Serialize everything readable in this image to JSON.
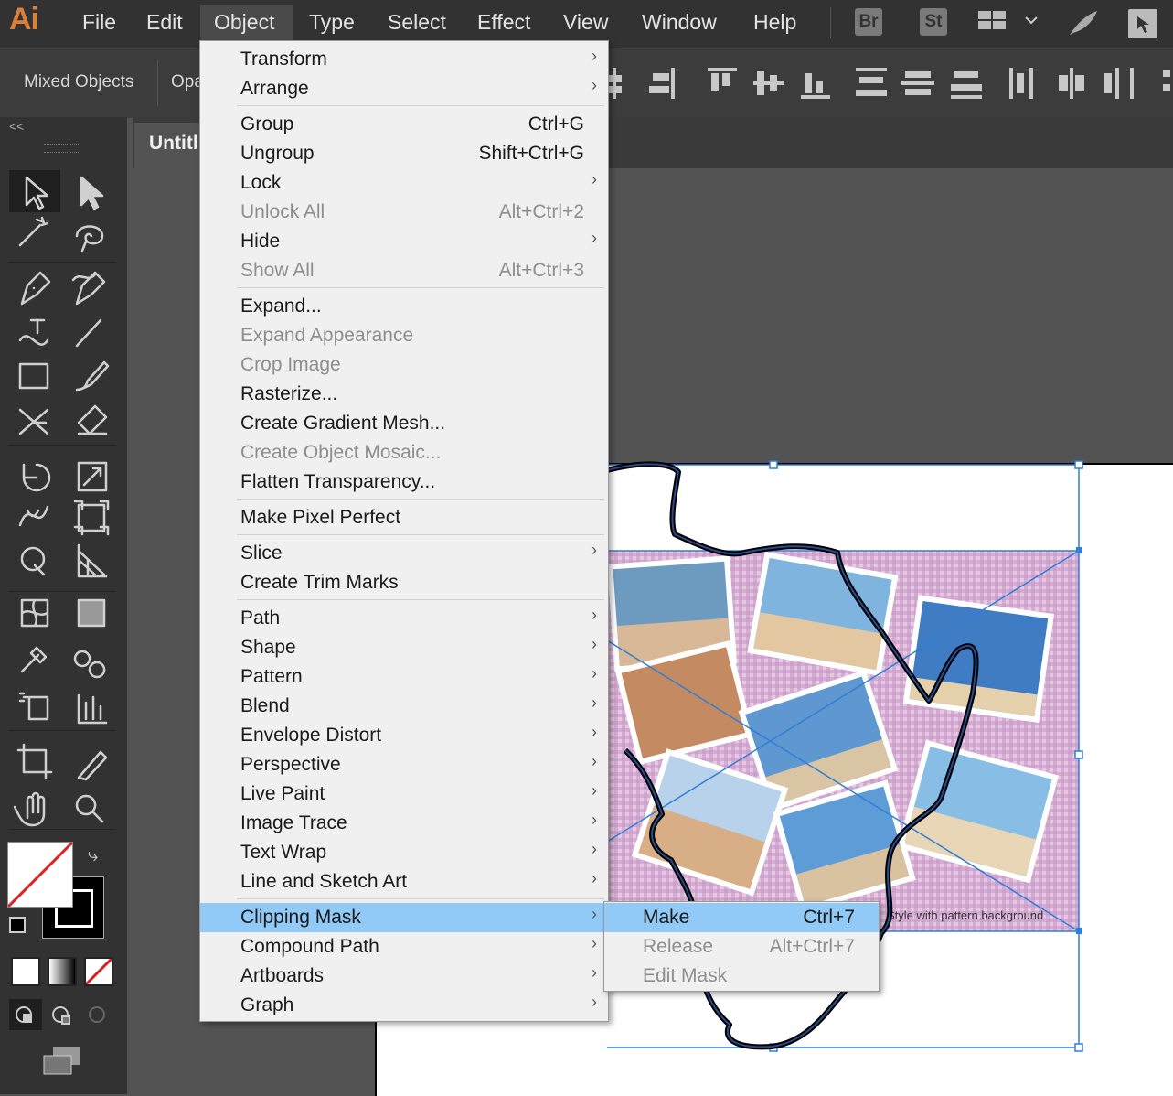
{
  "app": {
    "logo": "Ai"
  },
  "menubar": {
    "items": [
      "File",
      "Edit",
      "Object",
      "Type",
      "Select",
      "Effect",
      "View",
      "Window",
      "Help"
    ],
    "active": "Object",
    "bridge_label": "Br",
    "stock_label": "St"
  },
  "control_bar": {
    "selection_label": "Mixed Objects",
    "opacity_label": "Opa"
  },
  "document": {
    "tab_title": "Untitl"
  },
  "object_menu": {
    "items": [
      {
        "label": "Transform",
        "submenu": true
      },
      {
        "label": "Arrange",
        "submenu": true
      },
      {
        "separator": true
      },
      {
        "label": "Group",
        "shortcut": "Ctrl+G"
      },
      {
        "label": "Ungroup",
        "shortcut": "Shift+Ctrl+G"
      },
      {
        "label": "Lock",
        "submenu": true
      },
      {
        "label": "Unlock All",
        "shortcut": "Alt+Ctrl+2",
        "disabled": true
      },
      {
        "label": "Hide",
        "submenu": true
      },
      {
        "label": "Show All",
        "shortcut": "Alt+Ctrl+3",
        "disabled": true
      },
      {
        "separator": true
      },
      {
        "label": "Expand..."
      },
      {
        "label": "Expand Appearance",
        "disabled": true
      },
      {
        "label": "Crop Image",
        "disabled": true
      },
      {
        "label": "Rasterize..."
      },
      {
        "label": "Create Gradient Mesh..."
      },
      {
        "label": "Create Object Mosaic...",
        "disabled": true
      },
      {
        "label": "Flatten Transparency..."
      },
      {
        "separator": true
      },
      {
        "label": "Make Pixel Perfect"
      },
      {
        "separator": true
      },
      {
        "label": "Slice",
        "submenu": true
      },
      {
        "label": "Create Trim Marks"
      },
      {
        "separator": true
      },
      {
        "label": "Path",
        "submenu": true
      },
      {
        "label": "Shape",
        "submenu": true
      },
      {
        "label": "Pattern",
        "submenu": true
      },
      {
        "label": "Blend",
        "submenu": true
      },
      {
        "label": "Envelope Distort",
        "submenu": true
      },
      {
        "label": "Perspective",
        "submenu": true
      },
      {
        "label": "Live Paint",
        "submenu": true
      },
      {
        "label": "Image Trace",
        "submenu": true
      },
      {
        "label": "Text Wrap",
        "submenu": true
      },
      {
        "label": "Line and Sketch Art",
        "submenu": true
      },
      {
        "separator": true
      },
      {
        "label": "Clipping Mask",
        "submenu": true,
        "highlighted": true
      },
      {
        "label": "Compound Path",
        "submenu": true
      },
      {
        "label": "Artboards",
        "submenu": true
      },
      {
        "label": "Graph",
        "submenu": true
      }
    ]
  },
  "clipping_submenu": {
    "items": [
      {
        "label": "Make",
        "shortcut": "Ctrl+7",
        "highlighted": true
      },
      {
        "label": "Release",
        "shortcut": "Alt+Ctrl+7",
        "disabled": true
      },
      {
        "label": "Edit Mask",
        "disabled": true
      }
    ]
  },
  "artwork": {
    "caption": "Style with pattern background"
  },
  "colors": {
    "accent": "#91c9f7",
    "selection": "#2f7fd6",
    "logo": "#d9803a"
  }
}
